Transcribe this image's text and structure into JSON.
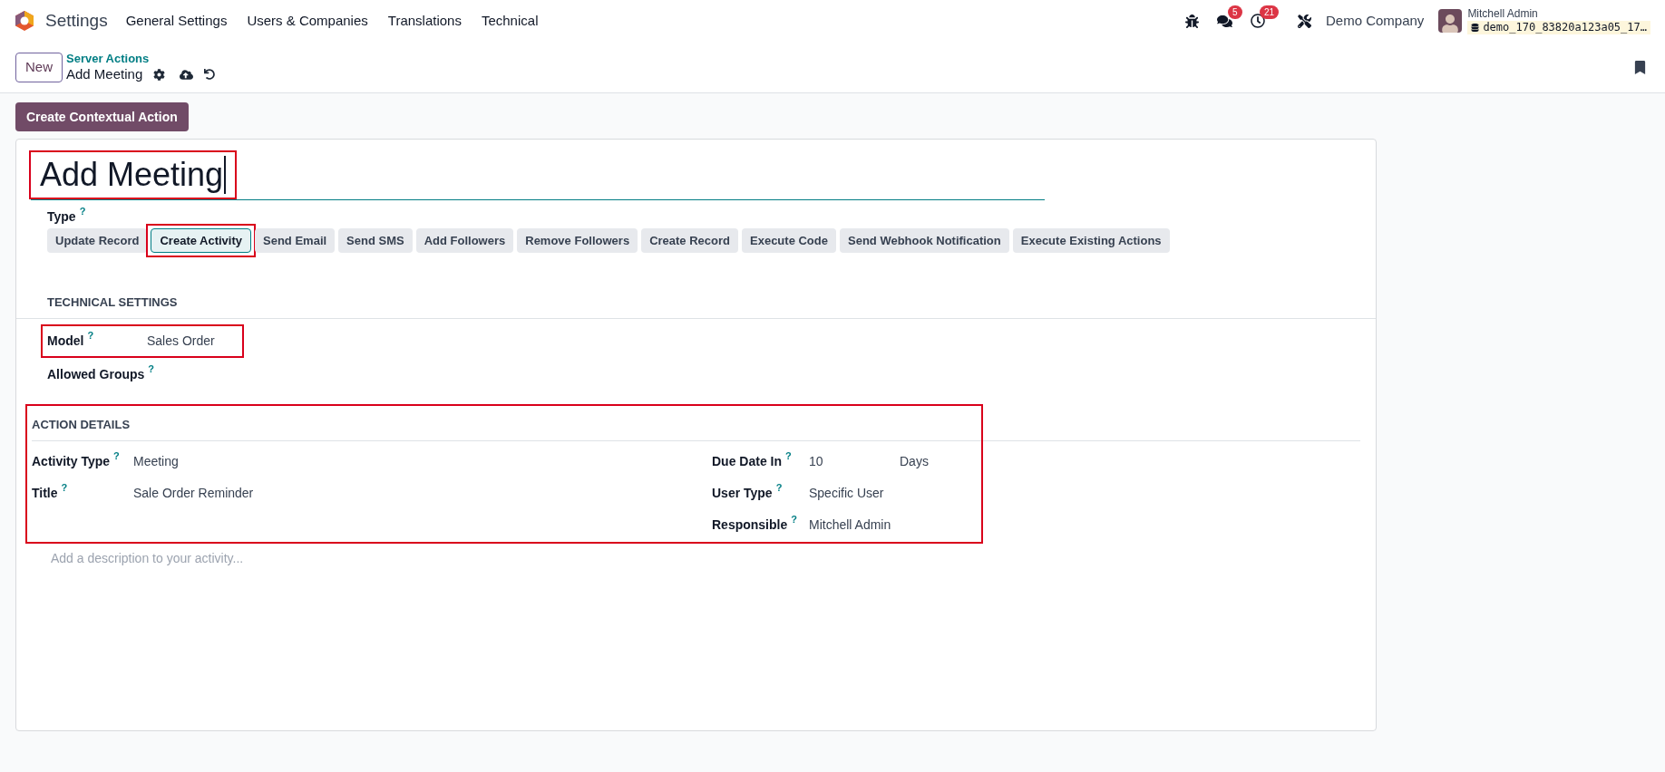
{
  "navbar": {
    "app": "Settings",
    "menu": [
      "General Settings",
      "Users & Companies",
      "Translations",
      "Technical"
    ],
    "chat_badge": "5",
    "activity_badge": "21",
    "company": "Demo Company",
    "user": {
      "name": "Mitchell Admin",
      "database": "demo_170_83820a123a05_17…"
    }
  },
  "control_panel": {
    "new_button": "New",
    "breadcrumb": "Server Actions",
    "record": "Add Meeting"
  },
  "contextual_button": "Create Contextual Action",
  "form": {
    "title": {
      "value": "Add Meeting",
      "highlighted": true
    },
    "type": {
      "label": "Type",
      "help": "?",
      "options": [
        {
          "label": "Update Record",
          "selected": false,
          "highlighted": false
        },
        {
          "label": "Create Activity",
          "selected": true,
          "highlighted": true
        },
        {
          "label": "Send Email",
          "selected": false,
          "highlighted": false
        },
        {
          "label": "Send SMS",
          "selected": false,
          "highlighted": false
        },
        {
          "label": "Add Followers",
          "selected": false,
          "highlighted": false
        },
        {
          "label": "Remove Followers",
          "selected": false,
          "highlighted": false
        },
        {
          "label": "Create Record",
          "selected": false,
          "highlighted": false
        },
        {
          "label": "Execute Code",
          "selected": false,
          "highlighted": false
        },
        {
          "label": "Send Webhook Notification",
          "selected": false,
          "highlighted": false
        },
        {
          "label": "Execute Existing Actions",
          "selected": false,
          "highlighted": false
        }
      ]
    },
    "technical_settings": {
      "heading": "TECHNICAL SETTINGS",
      "fields": [
        {
          "label": "Model",
          "help": "?",
          "value": "Sales Order",
          "highlighted": true
        },
        {
          "label": "Allowed Groups",
          "help": "?",
          "highlighted": false
        }
      ]
    },
    "action_details": {
      "heading": "ACTION DETAILS",
      "highlighted": true,
      "left_fields": [
        {
          "label": "Activity Type",
          "help": "?",
          "value": "Meeting"
        },
        {
          "label": "Title",
          "help": "?",
          "value": "Sale Order Reminder"
        }
      ],
      "right_fields": [
        {
          "label": "Due Date In",
          "help": "?",
          "value": "10",
          "unit": "Days"
        },
        {
          "label": "User Type",
          "help": "?",
          "value": "Specific User"
        },
        {
          "label": "Responsible",
          "help": "?",
          "value": "Mitchell Admin"
        }
      ]
    },
    "description": {
      "placeholder": "Add a description to your activity..."
    }
  }
}
